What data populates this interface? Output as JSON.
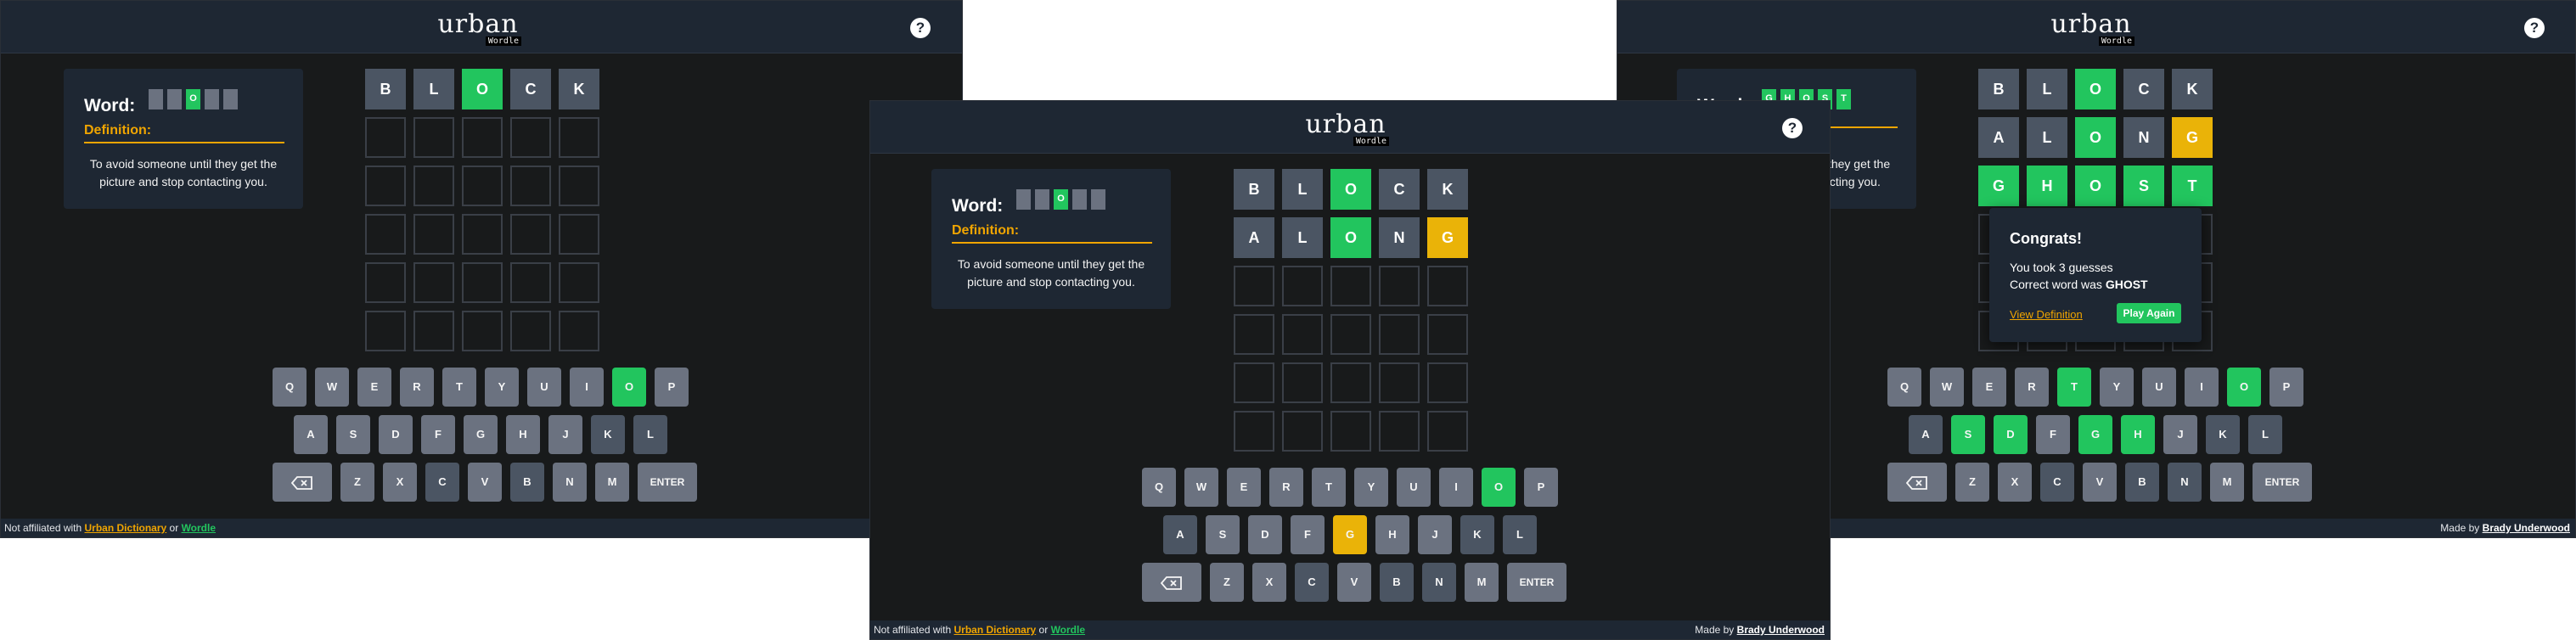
{
  "app": {
    "logo_word": "urban",
    "logo_sub": "Wordle",
    "help_label": "?"
  },
  "word_card": {
    "label": "Word:",
    "definition_title": "Definition:",
    "definition": "To avoid someone until they get the picture and stop contacting you.",
    "revealed_letter": "O",
    "right_partial_letters": [
      "G",
      "H",
      "O",
      "S",
      "T"
    ]
  },
  "footer": {
    "left_prefix": "Not affiliated with",
    "link1": "Urban Dictionary",
    "conjunction": "or",
    "link2": "Wordle",
    "made_by_prefix": "Made by",
    "author": "Brady Underwood"
  },
  "keyboard": {
    "rows": [
      [
        "Q",
        "W",
        "E",
        "R",
        "T",
        "Y",
        "U",
        "I",
        "O",
        "P"
      ],
      [
        "A",
        "S",
        "D",
        "F",
        "G",
        "H",
        "J",
        "K",
        "L"
      ],
      [
        "BACKSPACE",
        "Z",
        "X",
        "C",
        "V",
        "B",
        "N",
        "M",
        "ENTER"
      ]
    ],
    "enter_label": "ENTER"
  },
  "screens": {
    "left": {
      "guesses": [
        [
          [
            "B",
            "absent"
          ],
          [
            "L",
            "absent"
          ],
          [
            "O",
            "correct"
          ],
          [
            "C",
            "absent"
          ],
          [
            "K",
            "absent"
          ]
        ]
      ],
      "key_states": {
        "O": "correct",
        "B": "absent",
        "L": "absent",
        "C": "absent",
        "K": "absent"
      }
    },
    "center": {
      "guesses": [
        [
          [
            "B",
            "absent"
          ],
          [
            "L",
            "absent"
          ],
          [
            "O",
            "correct"
          ],
          [
            "C",
            "absent"
          ],
          [
            "K",
            "absent"
          ]
        ],
        [
          [
            "A",
            "absent"
          ],
          [
            "L",
            "absent"
          ],
          [
            "O",
            "correct"
          ],
          [
            "N",
            "absent"
          ],
          [
            "G",
            "present"
          ]
        ]
      ],
      "key_states": {
        "O": "correct",
        "G": "present",
        "B": "absent",
        "L": "absent",
        "C": "absent",
        "K": "absent",
        "A": "absent",
        "N": "absent"
      }
    },
    "right": {
      "guesses": [
        [
          [
            "B",
            "absent"
          ],
          [
            "L",
            "absent"
          ],
          [
            "O",
            "correct"
          ],
          [
            "C",
            "absent"
          ],
          [
            "K",
            "absent"
          ]
        ],
        [
          [
            "A",
            "absent"
          ],
          [
            "L",
            "absent"
          ],
          [
            "O",
            "correct"
          ],
          [
            "N",
            "absent"
          ],
          [
            "G",
            "present"
          ]
        ],
        [
          [
            "G",
            "correct"
          ],
          [
            "H",
            "correct"
          ],
          [
            "O",
            "correct"
          ],
          [
            "S",
            "correct"
          ],
          [
            "T",
            "correct"
          ]
        ]
      ],
      "key_states": {
        "T": "correct",
        "O": "correct",
        "S": "correct",
        "D": "correct",
        "G": "correct",
        "H": "correct",
        "L": "absent",
        "B": "absent",
        "N": "absent",
        "C": "absent",
        "K": "absent",
        "A": "absent"
      }
    }
  },
  "modal": {
    "title": "Congrats!",
    "line1": "You took 3 guesses",
    "line2_prefix": "Correct word was",
    "word": "GHOST",
    "link": "View Definition",
    "button": "Play Again"
  },
  "colors": {
    "bg": "#181a1b",
    "panel": "#1e2733",
    "correct": "#22c55e",
    "present": "#eab308",
    "absent": "#4b5563",
    "key": "#6b7280",
    "accent": "#f0a500"
  }
}
